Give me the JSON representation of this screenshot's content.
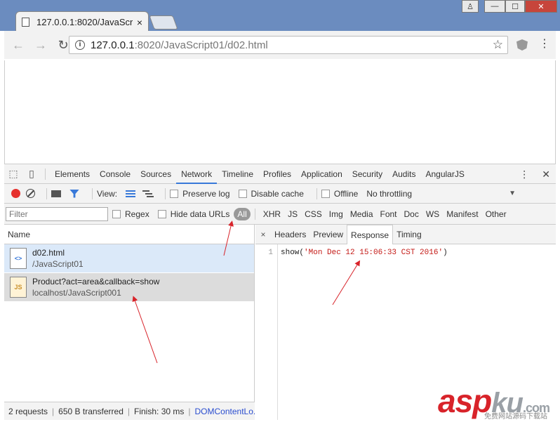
{
  "browser": {
    "tab_title": "127.0.0.1:8020/JavaScri",
    "tab_close": "×",
    "window_buttons": {
      "user": "♙",
      "minimize": "—",
      "maximize": "☐",
      "close": "✕"
    },
    "url_host": "127.0.0.1",
    "url_rest": ":8020/JavaScript01/d02.html",
    "info": "i",
    "star": "☆",
    "menu": "⋮",
    "back": "←",
    "forward": "→",
    "reload": "↻"
  },
  "devtools": {
    "tabs": [
      "Elements",
      "Console",
      "Sources",
      "Network",
      "Timeline",
      "Profiles",
      "Application",
      "Security",
      "Audits",
      "AngularJS"
    ],
    "active_tab": "Network",
    "more": "⋮",
    "close": "✕",
    "network_bar": {
      "view_label": "View:",
      "preserve_log": "Preserve log",
      "disable_cache": "Disable cache",
      "offline": "Offline",
      "throttling": "No throttling",
      "dropdown": "▼"
    },
    "filter_bar": {
      "filter_placeholder": "Filter",
      "regex": "Regex",
      "hide_data_urls": "Hide data URLs",
      "types": [
        "All",
        "XHR",
        "JS",
        "CSS",
        "Img",
        "Media",
        "Font",
        "Doc",
        "WS",
        "Manifest",
        "Other"
      ]
    },
    "list": {
      "header": "Name",
      "rows": [
        {
          "icon": "<>",
          "name": "d02.html",
          "path": "/JavaScript01"
        },
        {
          "icon": "JS",
          "name": "Product?act=area&callback=show",
          "path": "localhost/JavaScript001"
        }
      ]
    },
    "status": {
      "requests": "2 requests",
      "transferred": "650 B transferred",
      "finish": "Finish: 30 ms",
      "dcl": "DOMContentLo...",
      "bar": "|"
    },
    "detail": {
      "close": "×",
      "tabs": [
        "Headers",
        "Preview",
        "Response",
        "Timing"
      ],
      "active_tab": "Response",
      "line_number": "1",
      "code_prefix": "show(",
      "code_string": "'Mon Dec 12 15:06:33 CST 2016'",
      "code_suffix": ")"
    }
  },
  "watermark": {
    "asp": "asp",
    "ku": "ku",
    "com": ".com",
    "sub": "免费网站源码下载站"
  },
  "colors": {
    "accent": "#3879d9",
    "record": "#e6312e",
    "arrow": "#d8232a"
  }
}
